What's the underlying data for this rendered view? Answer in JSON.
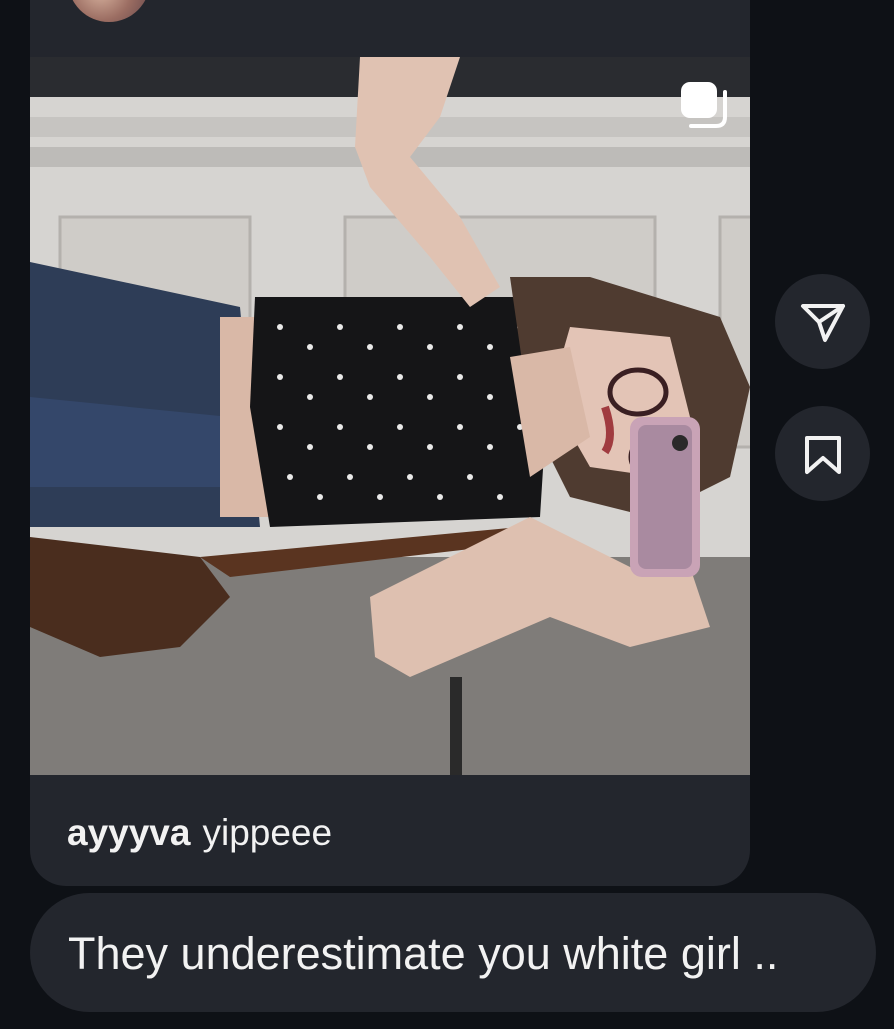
{
  "post": {
    "caption_user": "ayyyva",
    "caption_text": "yippeee",
    "multi_media_icon": "carousel-icon"
  },
  "actions": {
    "share_icon": "send-icon",
    "save_icon": "bookmark-icon"
  },
  "reply": {
    "text": "They underestimate you white girl .."
  },
  "colors": {
    "background": "#0e1116",
    "bubble": "#23262d",
    "text": "#f2f2f2"
  }
}
